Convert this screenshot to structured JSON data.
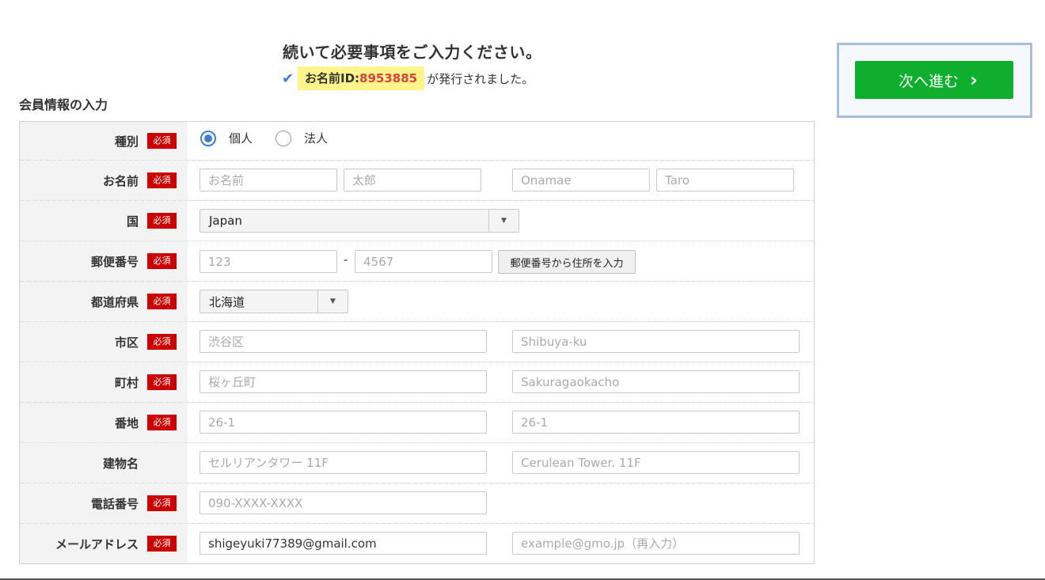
{
  "header": {
    "heading": "続いて必要事項をご入力ください。",
    "id_label": "お名前ID:",
    "id_number": "8953885",
    "issued_suffix": "が発行されました。"
  },
  "section_title": "会員情報の入力",
  "required_badge": "必須",
  "next_button": {
    "label": "次へ進む",
    "chevron": "›"
  },
  "colors": {
    "required": "#cc0000",
    "accent": "#3b7dd8",
    "next_button": "#0fae2f",
    "id_highlight": "#fff58a"
  },
  "form": {
    "type": {
      "label": "種別",
      "options": [
        "個人",
        "法人"
      ],
      "selected": "個人"
    },
    "name": {
      "label": "お名前",
      "placeholders": [
        "お名前",
        "太郎",
        "Onamae",
        "Taro"
      ]
    },
    "country": {
      "label": "国",
      "value": "Japan"
    },
    "postal": {
      "label": "郵便番号",
      "placeholders": [
        "123",
        "4567"
      ],
      "dash": "-",
      "lookup_button": "郵便番号から住所を入力"
    },
    "prefecture": {
      "label": "都道府県",
      "value": "北海道"
    },
    "city": {
      "label": "市区",
      "placeholders": [
        "渋谷区",
        "Shibuya-ku"
      ]
    },
    "town": {
      "label": "町村",
      "placeholders": [
        "桜ヶ丘町",
        "Sakuragaokacho"
      ]
    },
    "address": {
      "label": "番地",
      "placeholders": [
        "26-1",
        "26-1"
      ]
    },
    "building": {
      "label": "建物名",
      "placeholders": [
        "セルリアンタワー 11F",
        "Cerulean Tower. 11F"
      ]
    },
    "phone": {
      "label": "電話番号",
      "placeholder": "090-XXXX-XXXX"
    },
    "email": {
      "label": "メールアドレス",
      "value": "shigeyuki77389@gmail.com",
      "confirm_placeholder": "example@gmo.jp（再入力）"
    }
  }
}
